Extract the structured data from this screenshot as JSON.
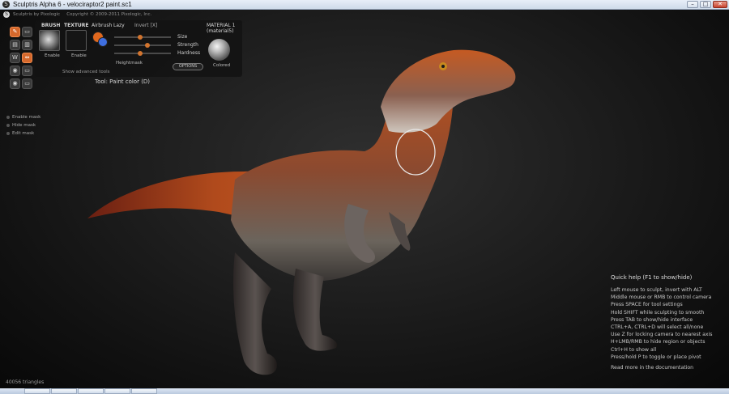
{
  "window": {
    "title": "Sculptris Alpha 6 - velociraptor2 paint.sc1",
    "minimize": "–",
    "maximize": "□",
    "close": "✕"
  },
  "header": {
    "brand": "Sculptris by Pixologic",
    "copyright": "Copyright © 2009-2011 Pixologic, Inc."
  },
  "toolbar": {
    "tools": [
      {
        "name": "paint-tool",
        "glyph": "✎",
        "active": true
      },
      {
        "name": "tool-2",
        "glyph": "▭",
        "active": false
      },
      {
        "name": "tool-3",
        "glyph": "▤",
        "active": false
      },
      {
        "name": "tool-4",
        "glyph": "▥",
        "active": false
      },
      {
        "name": "tool-5",
        "glyph": "W",
        "active": false
      },
      {
        "name": "tool-6",
        "glyph": "⇔",
        "active": true
      },
      {
        "name": "tool-7",
        "glyph": "◉",
        "active": false
      },
      {
        "name": "tool-8",
        "glyph": "▭",
        "active": false
      },
      {
        "name": "tool-9",
        "glyph": "◉",
        "active": false
      },
      {
        "name": "tool-10",
        "glyph": "▭",
        "active": false
      }
    ]
  },
  "mask": {
    "enable": "Enable mask",
    "hide": "Hide mask",
    "edit": "Edit mask"
  },
  "panel": {
    "brush_label": "BRUSH",
    "texture_label": "TEXTURE",
    "airbrush_label": "Airbrush",
    "lazy_label": "Lazy",
    "invert_label": "Invert [X]",
    "brush_enable": "Enable",
    "texture_enable": "Enable",
    "heightmask_label": "Heightmask",
    "show_advanced": "Show advanced tools",
    "size_label": "Size",
    "strength_label": "Strength",
    "hardness_label": "Hardness",
    "options_label": "OPTIONS",
    "material_label": "MATERIAL 1 (material5)",
    "colored_label": "Colored",
    "size_value": 0.45,
    "strength_value": 0.6,
    "hardness_value": 0.45,
    "primary_color": "#e0681e",
    "secondary_color": "#3f6fe0"
  },
  "tool_caption": "Tool: Paint color (D)",
  "quick_help": {
    "title": "Quick help (F1 to show/hide)",
    "lines": [
      "Left mouse to sculpt, invert with ALT",
      "Middle mouse or RMB to control camera",
      "Press SPACE for tool settings",
      "Hold SHIFT while sculpting to smooth",
      "Press TAB to show/hide interface",
      "CTRL+A, CTRL+D will select all/none",
      "Use Z for locking camera to nearest axis",
      "H+LMB/RMB to hide region or objects",
      "Ctrl+H to show all",
      "Press/hold P to toggle or place pivot"
    ],
    "footer": "Read more in the documentation"
  },
  "status": {
    "triangles": "40056 triangles"
  }
}
